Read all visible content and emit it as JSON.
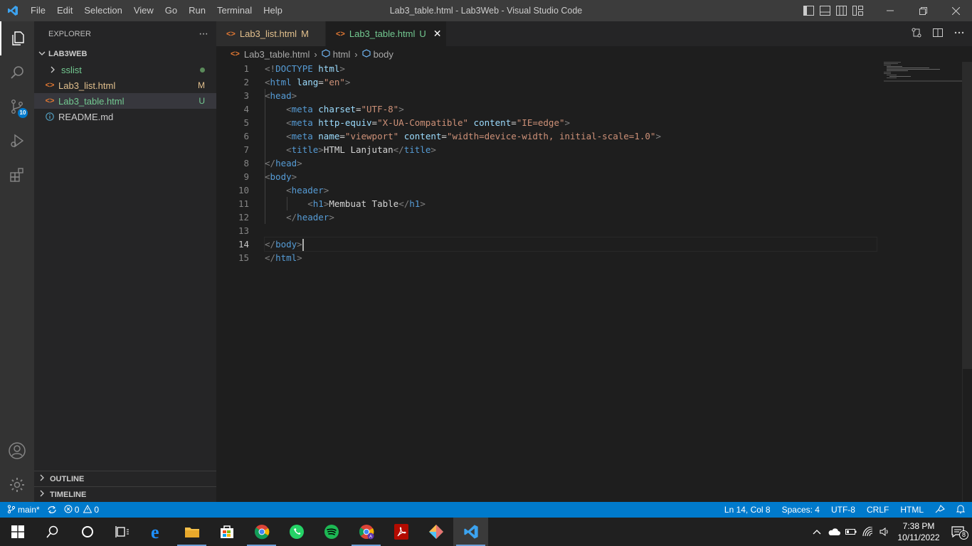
{
  "titlebar": {
    "menu": [
      "File",
      "Edit",
      "Selection",
      "View",
      "Go",
      "Run",
      "Terminal",
      "Help"
    ],
    "window_title": "Lab3_table.html - Lab3Web - Visual Studio Code"
  },
  "activitybar": {
    "source_control_badge": "10"
  },
  "sidebar": {
    "title": "EXPLORER",
    "more": "···",
    "folder": "LAB3WEB",
    "items": [
      {
        "name": "sslist",
        "type": "folder",
        "decoration": "",
        "color": "#73c991"
      },
      {
        "name": "Lab3_list.html",
        "type": "html",
        "decoration": "M",
        "color": "#e2c08d"
      },
      {
        "name": "Lab3_table.html",
        "type": "html",
        "decoration": "U",
        "color": "#73c991"
      },
      {
        "name": "README.md",
        "type": "info",
        "decoration": "",
        "color": "#cccccc"
      }
    ],
    "outline": "OUTLINE",
    "timeline": "TIMELINE"
  },
  "tabs": [
    {
      "label": "Lab3_list.html",
      "flag": "M",
      "active": false
    },
    {
      "label": "Lab3_table.html",
      "flag": "U",
      "active": true,
      "close": "✕"
    }
  ],
  "breadcrumb": {
    "file": "Lab3_table.html",
    "html": "html",
    "body": "body"
  },
  "editor": {
    "line_numbers": [
      "1",
      "2",
      "3",
      "4",
      "5",
      "6",
      "7",
      "8",
      "9",
      "10",
      "11",
      "12",
      "13",
      "14",
      "15"
    ],
    "current_line": 14
  },
  "status": {
    "branch": "main*",
    "errors": "0",
    "warnings": "0",
    "position": "Ln 14, Col 8",
    "spaces": "Spaces: 4",
    "encoding": "UTF-8",
    "eol": "CRLF",
    "language": "HTML"
  },
  "taskbar": {
    "time": "7:38 PM",
    "date": "10/11/2022",
    "notification_count": "8"
  },
  "colors": {
    "accent": "#007acc",
    "modified": "#e2c08d",
    "untracked": "#73c991"
  }
}
